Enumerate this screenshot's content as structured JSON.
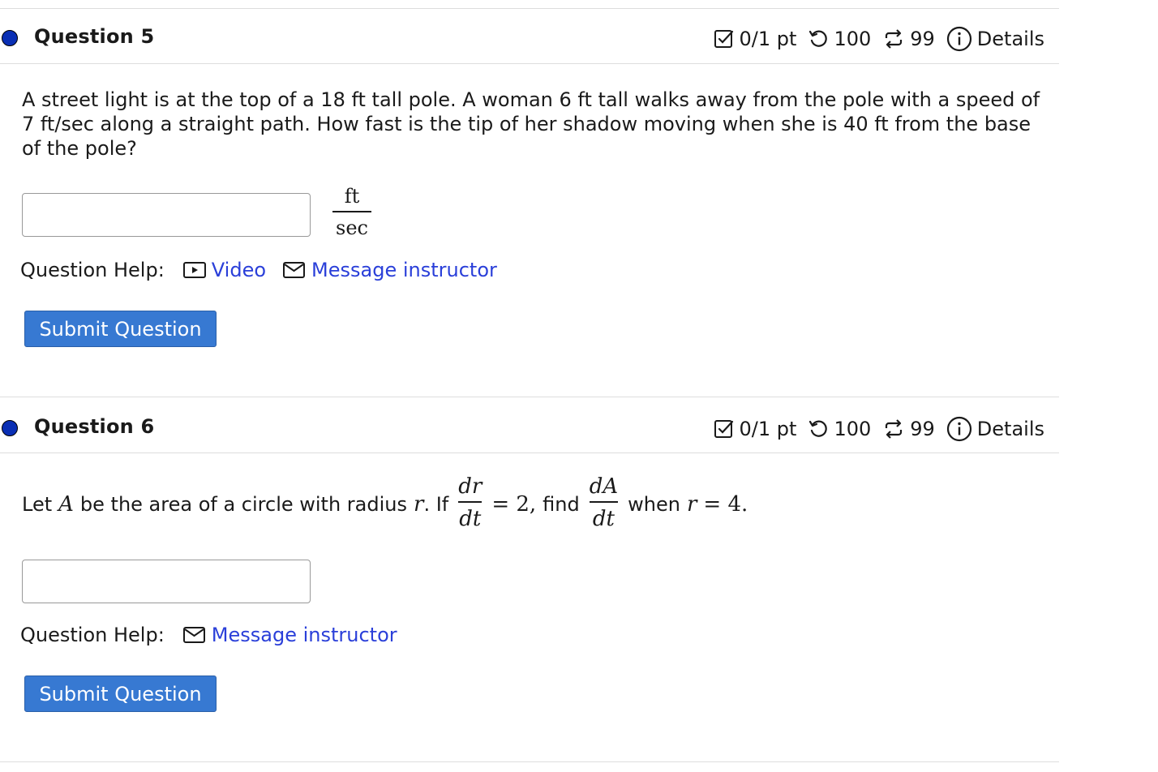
{
  "colors": {
    "question_dot": "#0a2fb4",
    "link": "#2a3fd9",
    "submit_bg": "#3779d2",
    "divider": "#dddddd"
  },
  "icons": {
    "score": "check-square-icon",
    "retry": "undo-icon",
    "attempts": "refresh-arrows-icon",
    "details": "info-circle-icon",
    "video": "video-play-icon",
    "message": "envelope-icon"
  },
  "q5": {
    "title": "Question 5",
    "score": "0/1 pt",
    "retries": "100",
    "attempts": "99",
    "details_label": "Details",
    "text": "A street light is at the top of a 18 ft tall pole. A woman 6 ft tall walks away from the pole with a speed of 7 ft/sec along a straight path. How fast is the tip of her shadow moving when she is 40 ft from the base of the pole?",
    "answer_value": "",
    "unit_num": "ft",
    "unit_den": "sec",
    "help_label": "Question Help:",
    "help_video": "Video",
    "help_message": "Message instructor",
    "submit_label": "Submit Question"
  },
  "q6": {
    "title": "Question 6",
    "score": "0/1 pt",
    "retries": "100",
    "attempts": "99",
    "details_label": "Details",
    "text_pre": "Let",
    "var_A": "A",
    "text_mid": "be the area of a circle with radius",
    "var_r": "r",
    "text_if": ". If",
    "frac1_num": "dr",
    "frac1_den": "dt",
    "eq_part": "= 2,",
    "text_find": "find",
    "frac2_num": "dA",
    "frac2_den": "dt",
    "text_when": "when",
    "var_r2": "r",
    "eq_end": "= 4.",
    "answer_value": "",
    "help_label": "Question Help:",
    "help_message": "Message instructor",
    "submit_label": "Submit Question"
  }
}
